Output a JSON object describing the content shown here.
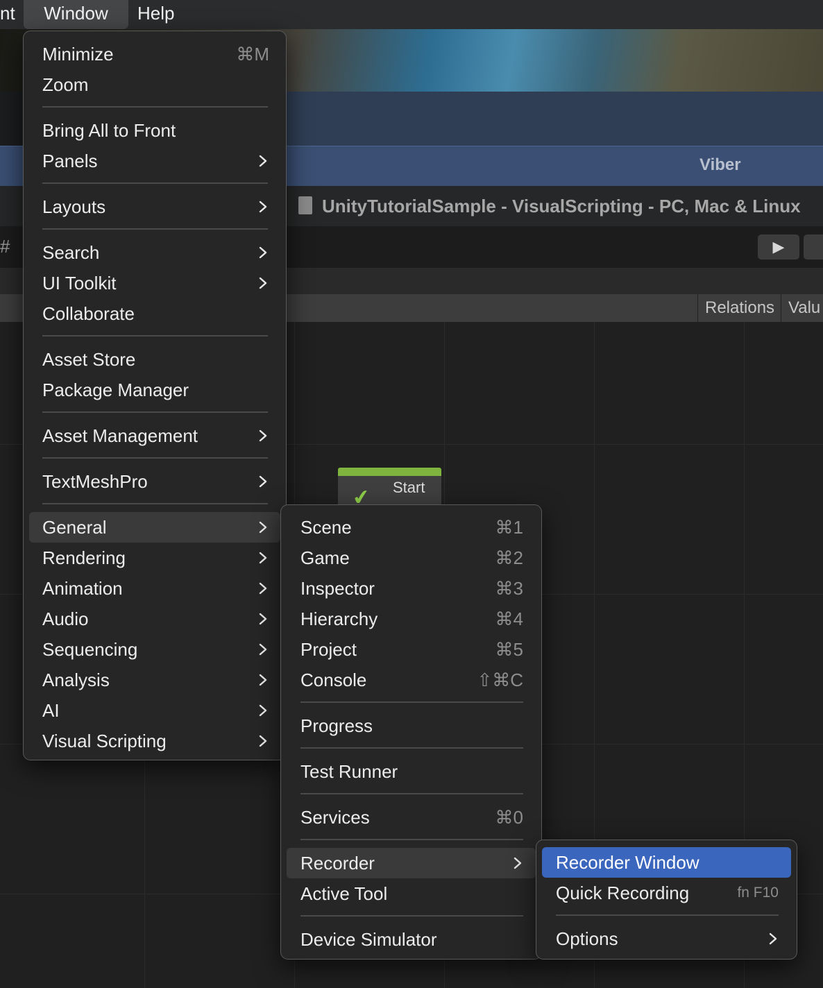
{
  "menubar": {
    "prev_item": "nt",
    "window": "Window",
    "help": "Help"
  },
  "background": {
    "viber_title": "Viber",
    "app_title": "UnityTutorialSample - VisualScripting - PC, Mac & Linux",
    "play_glyph": "▶",
    "tabs": {
      "relations": "Relations",
      "values": "Valu"
    },
    "node_label": "Start",
    "node_check": "✔",
    "hash_glyph": "#",
    "colors": {
      "node_header": "#7fb53f",
      "viber_bar": "#3a4f73"
    }
  },
  "window_menu": {
    "minimize": "Minimize",
    "minimize_sc": "⌘M",
    "zoom": "Zoom",
    "bring_all": "Bring All to Front",
    "panels": "Panels",
    "layouts": "Layouts",
    "search": "Search",
    "ui_toolkit": "UI Toolkit",
    "collaborate": "Collaborate",
    "asset_store": "Asset Store",
    "package_manager": "Package Manager",
    "asset_management": "Asset Management",
    "textmeshpro": "TextMeshPro",
    "general": "General",
    "rendering": "Rendering",
    "animation": "Animation",
    "audio": "Audio",
    "sequencing": "Sequencing",
    "analysis": "Analysis",
    "ai": "AI",
    "visual_scripting": "Visual Scripting"
  },
  "general_menu": {
    "scene": "Scene",
    "scene_sc": "⌘1",
    "game": "Game",
    "game_sc": "⌘2",
    "inspector": "Inspector",
    "inspector_sc": "⌘3",
    "hierarchy": "Hierarchy",
    "hierarchy_sc": "⌘4",
    "project": "Project",
    "project_sc": "⌘5",
    "console": "Console",
    "console_sc": "⇧⌘C",
    "progress": "Progress",
    "test_runner": "Test Runner",
    "services": "Services",
    "services_sc": "⌘0",
    "recorder": "Recorder",
    "active_tool": "Active Tool",
    "device_simulator": "Device Simulator"
  },
  "recorder_menu": {
    "recorder_window": "Recorder Window",
    "quick_recording": "Quick Recording",
    "quick_recording_sc": "fn F10",
    "options": "Options"
  },
  "colors": {
    "selection": "#3a66bd",
    "menu_bg": "#262626"
  },
  "icons": {
    "submenu": "chevron-right-icon",
    "unity": "unity-logo-icon",
    "play": "play-icon"
  }
}
